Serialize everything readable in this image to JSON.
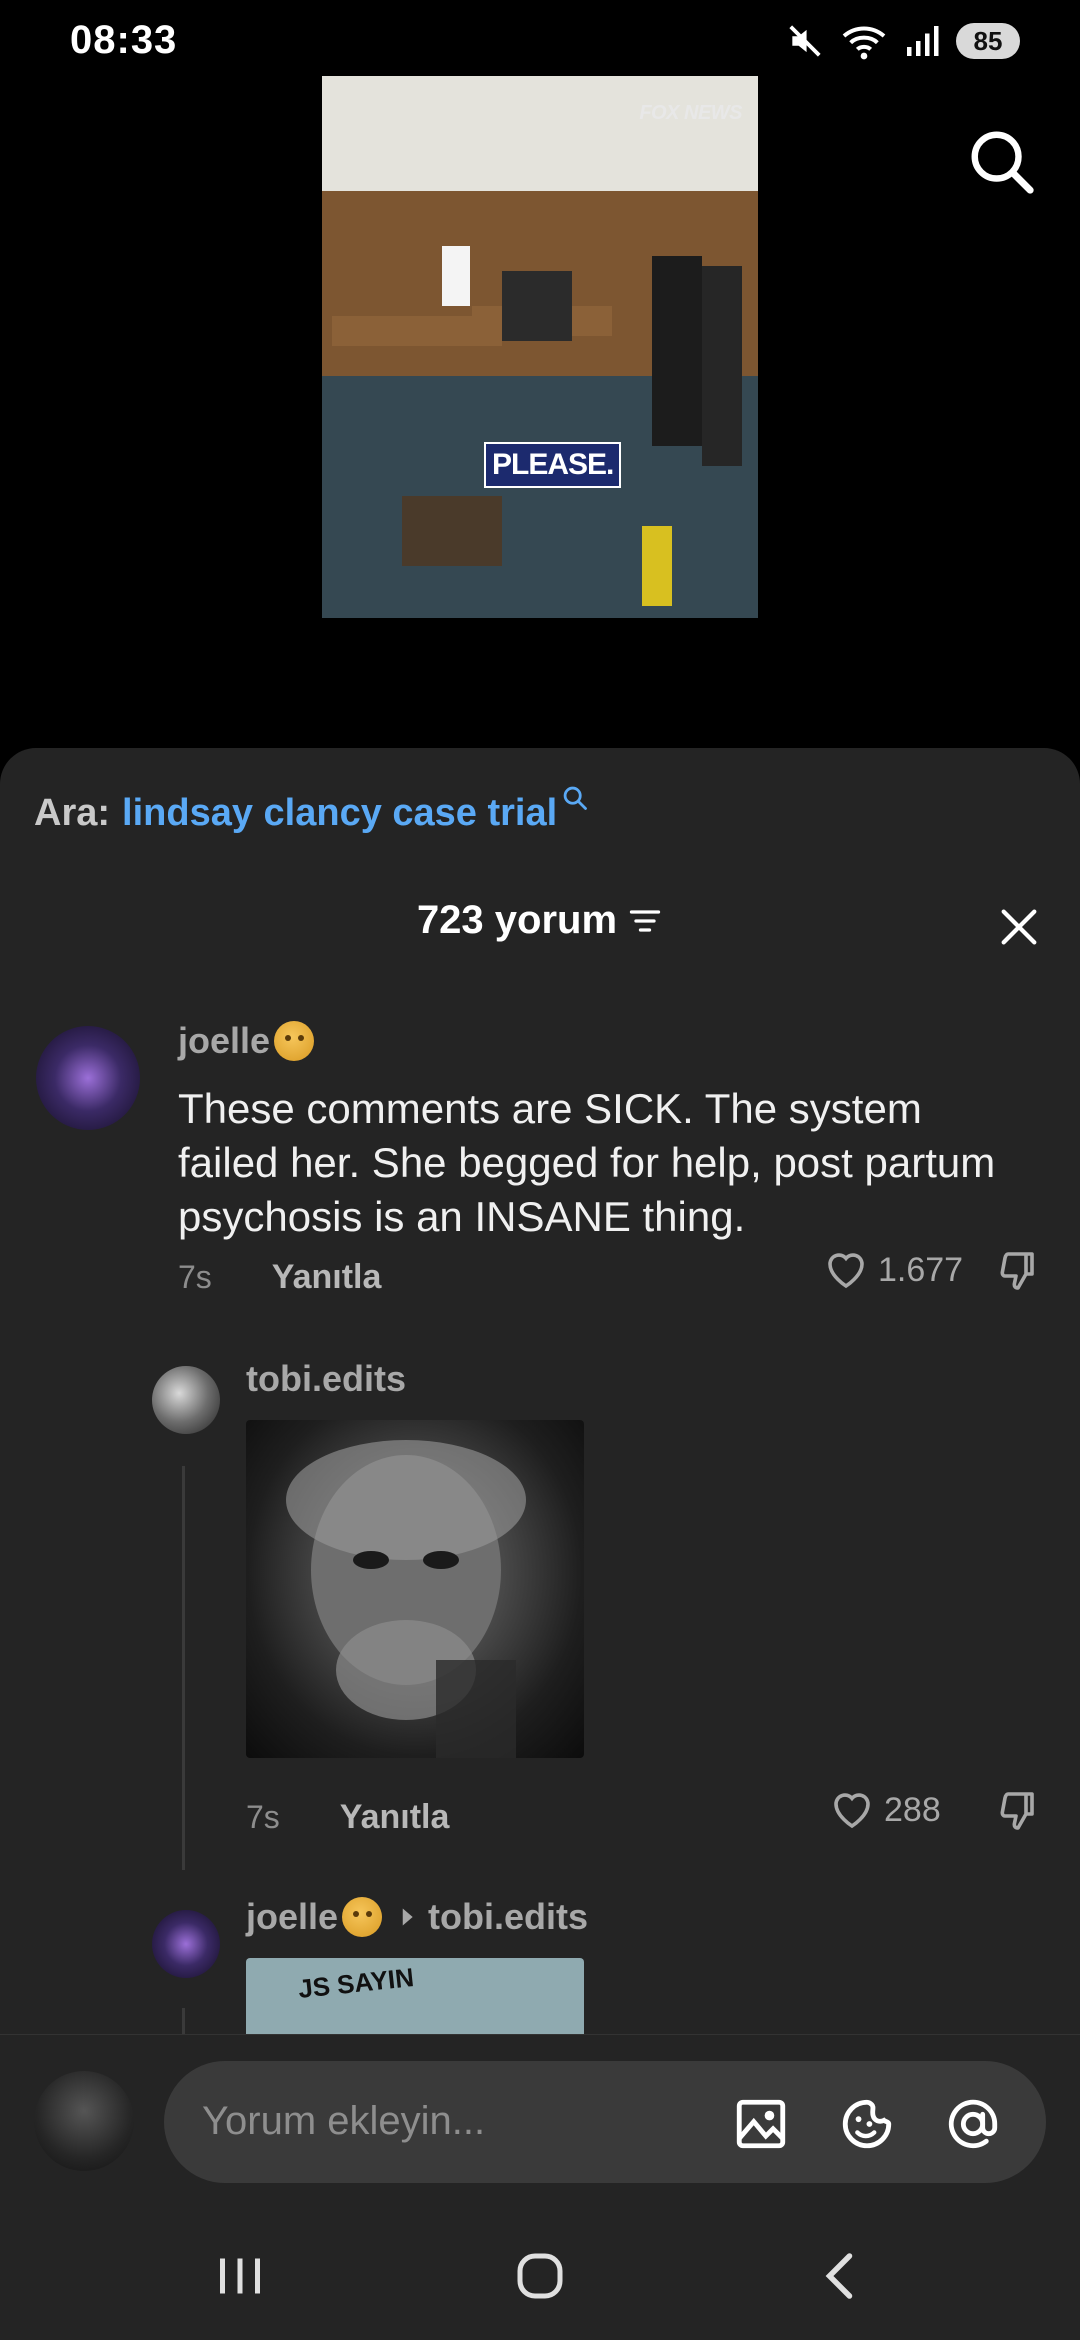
{
  "status_bar": {
    "time": "08:33",
    "battery": "85",
    "icons": [
      "mute-icon",
      "wifi-icon",
      "signal-icon"
    ]
  },
  "video": {
    "logo": "FOX NEWS",
    "caption": "PLEASE."
  },
  "related_search": {
    "prefix": "Ara:",
    "query": "lindsay clancy case trial"
  },
  "comments": {
    "count_label": "723 yorum",
    "items": [
      {
        "username": "joelle",
        "text": "These comments are SICK. The system failed her. She begged for help, post partum psychosis is an INSANE thing.",
        "time": "7s",
        "reply_label": "Yanıtla",
        "likes": "1.677"
      },
      {
        "username": "tobi.edits",
        "time": "7s",
        "reply_label": "Yanıtla",
        "likes": "288"
      },
      {
        "username": "joelle",
        "reply_to": "tobi.edits",
        "image_text": "JS SAYIN"
      }
    ]
  },
  "input": {
    "placeholder": "Yorum ekleyin..."
  },
  "colors": {
    "accent_link": "#5aa9f5",
    "sheet_bg": "#242424"
  }
}
